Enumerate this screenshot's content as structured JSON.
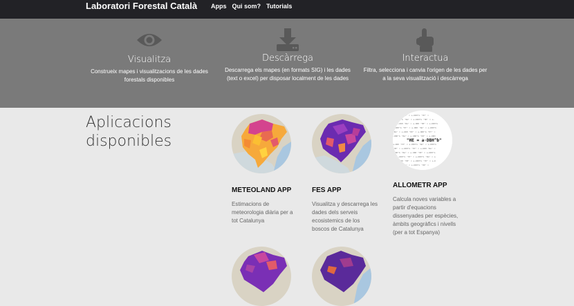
{
  "nav": {
    "brand": "Laboratori Forestal Català",
    "links": [
      "Apps",
      "Qui som?",
      "Tutorials"
    ]
  },
  "features": [
    {
      "icon": "eye-icon",
      "title": "Visualitza",
      "desc": "Construeix mapes i visualitzacions de les dades forestals disponibles"
    },
    {
      "icon": "download-icon",
      "title": "Descàrrega",
      "desc": "Descarrega els mapes (en formats SIG) i les dades (text o excel) per disposar localment de les dades"
    },
    {
      "icon": "hand-pointer-icon",
      "title": "Interactua",
      "desc": "Filtra, selecciona i canvia l'origen de les dades per a la seva visualització i descàrrega"
    }
  ],
  "section_title": "Aplicacions disponibles",
  "apps": [
    {
      "name": "METEOLAND APP",
      "desc": "Estimacions de meteorologia diària per a tot Catalunya"
    },
    {
      "name": "FES APP",
      "desc": "Visualitza y descarrega les dades dels serveis ecosistemics de los boscos de Catalunya"
    },
    {
      "name": "ALLOMETR APP",
      "desc": "Calcula noves variables a partir d'equacions dissenyades per espècies, àmbits geogràfics i nivells (per a tot Espanya)"
    }
  ],
  "allometr_formula": "\"HE = a·DBH^b\"",
  "colors": {
    "navbar": "#222226",
    "hero": "#7a7a7a",
    "body": "#e9e9e9",
    "map_water": "#a9c7e0"
  }
}
